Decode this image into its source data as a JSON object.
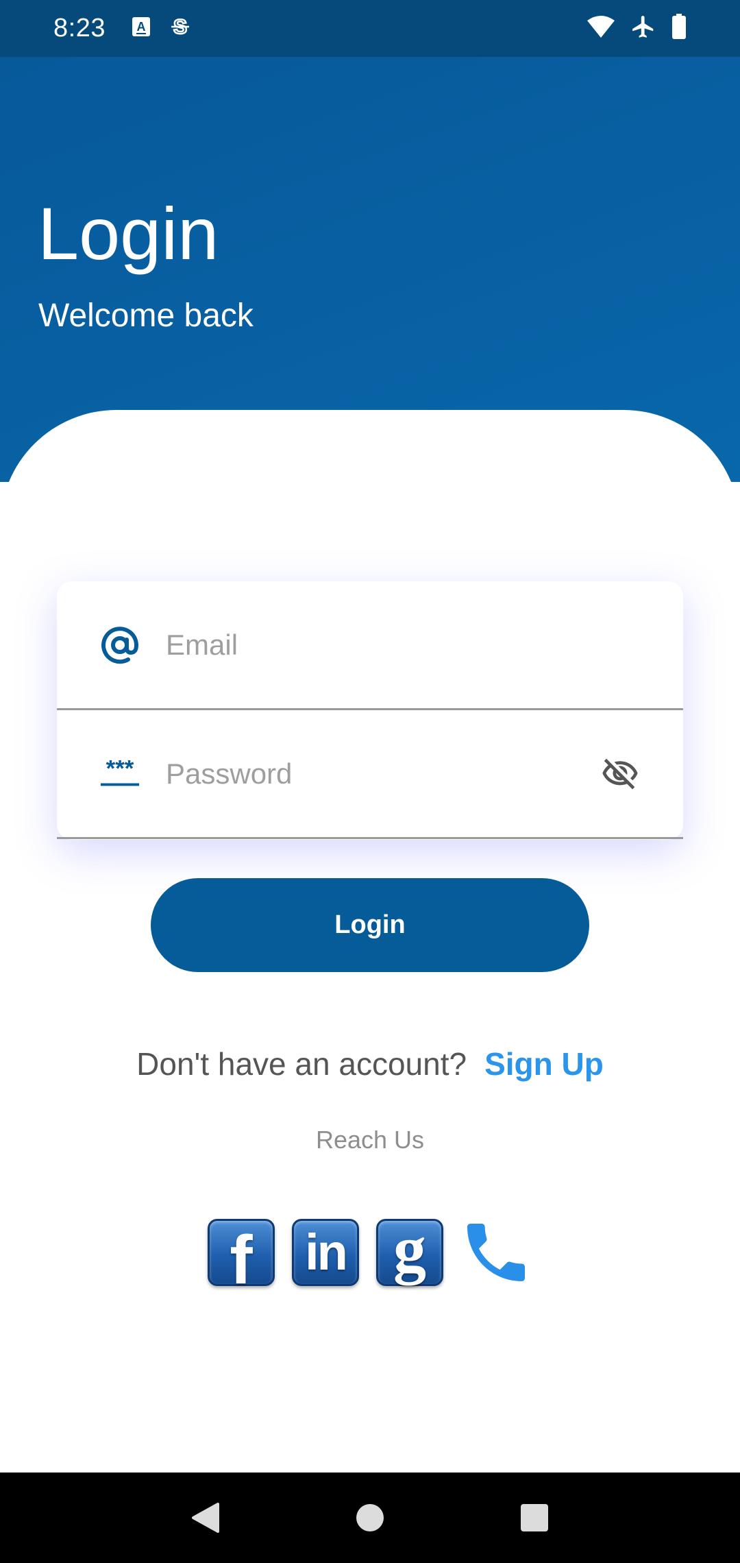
{
  "status_bar": {
    "time": "8:23",
    "left_icons": [
      "font-a-icon",
      "sync-s-icon"
    ],
    "right_icons": [
      "wifi-icon",
      "airplane-icon",
      "battery-icon"
    ]
  },
  "header": {
    "title": "Login",
    "subtitle": "Welcome back"
  },
  "form": {
    "email": {
      "placeholder": "Email",
      "value": "",
      "icon": "at-sign-icon"
    },
    "password": {
      "placeholder": "Password",
      "value": "",
      "icon": "password-icon",
      "toggle_icon": "eye-off-icon"
    }
  },
  "login_button": {
    "label": "Login"
  },
  "signup": {
    "prompt": "Don't have an account?",
    "link": "Sign Up"
  },
  "reach_us": {
    "label": "Reach Us",
    "icons": [
      "facebook-icon",
      "linkedin-icon",
      "google-icon",
      "phone-icon"
    ]
  },
  "colors": {
    "status_bar": "#054a7b",
    "header": "#07599a",
    "button": "#065b99",
    "link": "#2a95ea"
  },
  "nav_bar": {
    "icons": [
      "back-icon",
      "home-icon",
      "recents-icon"
    ]
  }
}
